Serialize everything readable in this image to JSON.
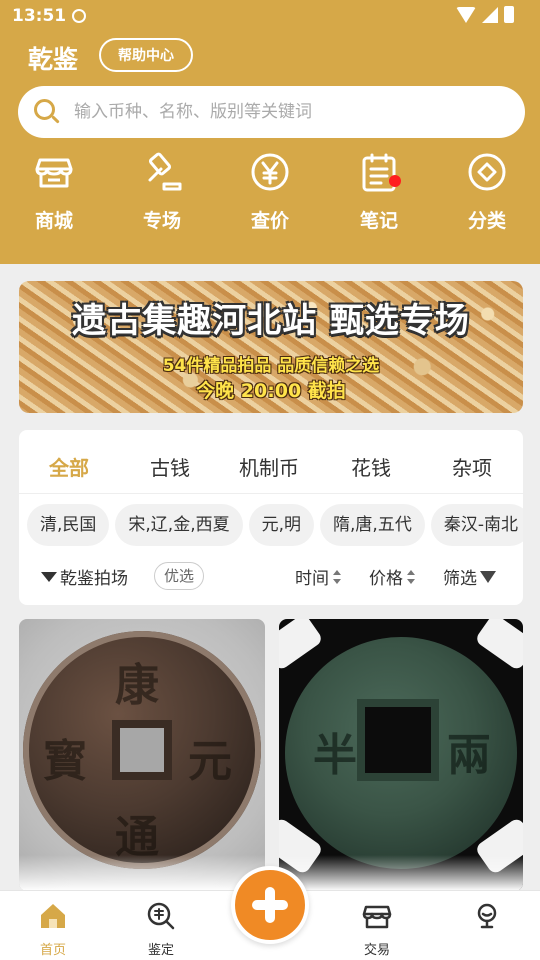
{
  "status_bar": {
    "time": "13:51"
  },
  "header": {
    "title": "乾鉴",
    "help_label": "帮助中心",
    "search": {
      "placeholder": "输入币种、名称、版别等关键词",
      "value": ""
    }
  },
  "quick_nav": [
    {
      "label": "商城",
      "icon": "shop-icon"
    },
    {
      "label": "专场",
      "icon": "auction-hammer-icon"
    },
    {
      "label": "查价",
      "icon": "yuan-icon"
    },
    {
      "label": "笔记",
      "icon": "notes-icon",
      "badge": true
    },
    {
      "label": "分类",
      "icon": "category-icon"
    }
  ],
  "banner": {
    "title": "遗古集趣河北站 甄选专场",
    "subtitle": "54件精品拍品 品质信赖之选",
    "time_text": "今晚 20:00 截拍"
  },
  "category_tabs": [
    {
      "label": "全部",
      "active": true
    },
    {
      "label": "古钱"
    },
    {
      "label": "机制币"
    },
    {
      "label": "花钱"
    },
    {
      "label": "杂项"
    }
  ],
  "era_chips": [
    "清,民国",
    "宋,辽,金,西夏",
    "元,明",
    "隋,唐,五代",
    "秦汉-南北"
  ],
  "filter": {
    "auction_label": "乾鉴拍场",
    "badge": "优选",
    "sort_time": "时间",
    "sort_price": "价格",
    "filter_label": "筛选"
  },
  "bottom_nav": [
    {
      "label": "首页",
      "icon": "home-icon",
      "active": true
    },
    {
      "label": "鉴定",
      "icon": "appraise-icon"
    },
    {
      "label": "交易",
      "icon": "trade-icon"
    },
    {
      "label": "",
      "icon": "profile-icon"
    }
  ],
  "fab_icon": "plus-icon",
  "colors": {
    "brand": "#d6a848",
    "accent": "#f08a25",
    "badge_red": "#ff1f1f"
  }
}
